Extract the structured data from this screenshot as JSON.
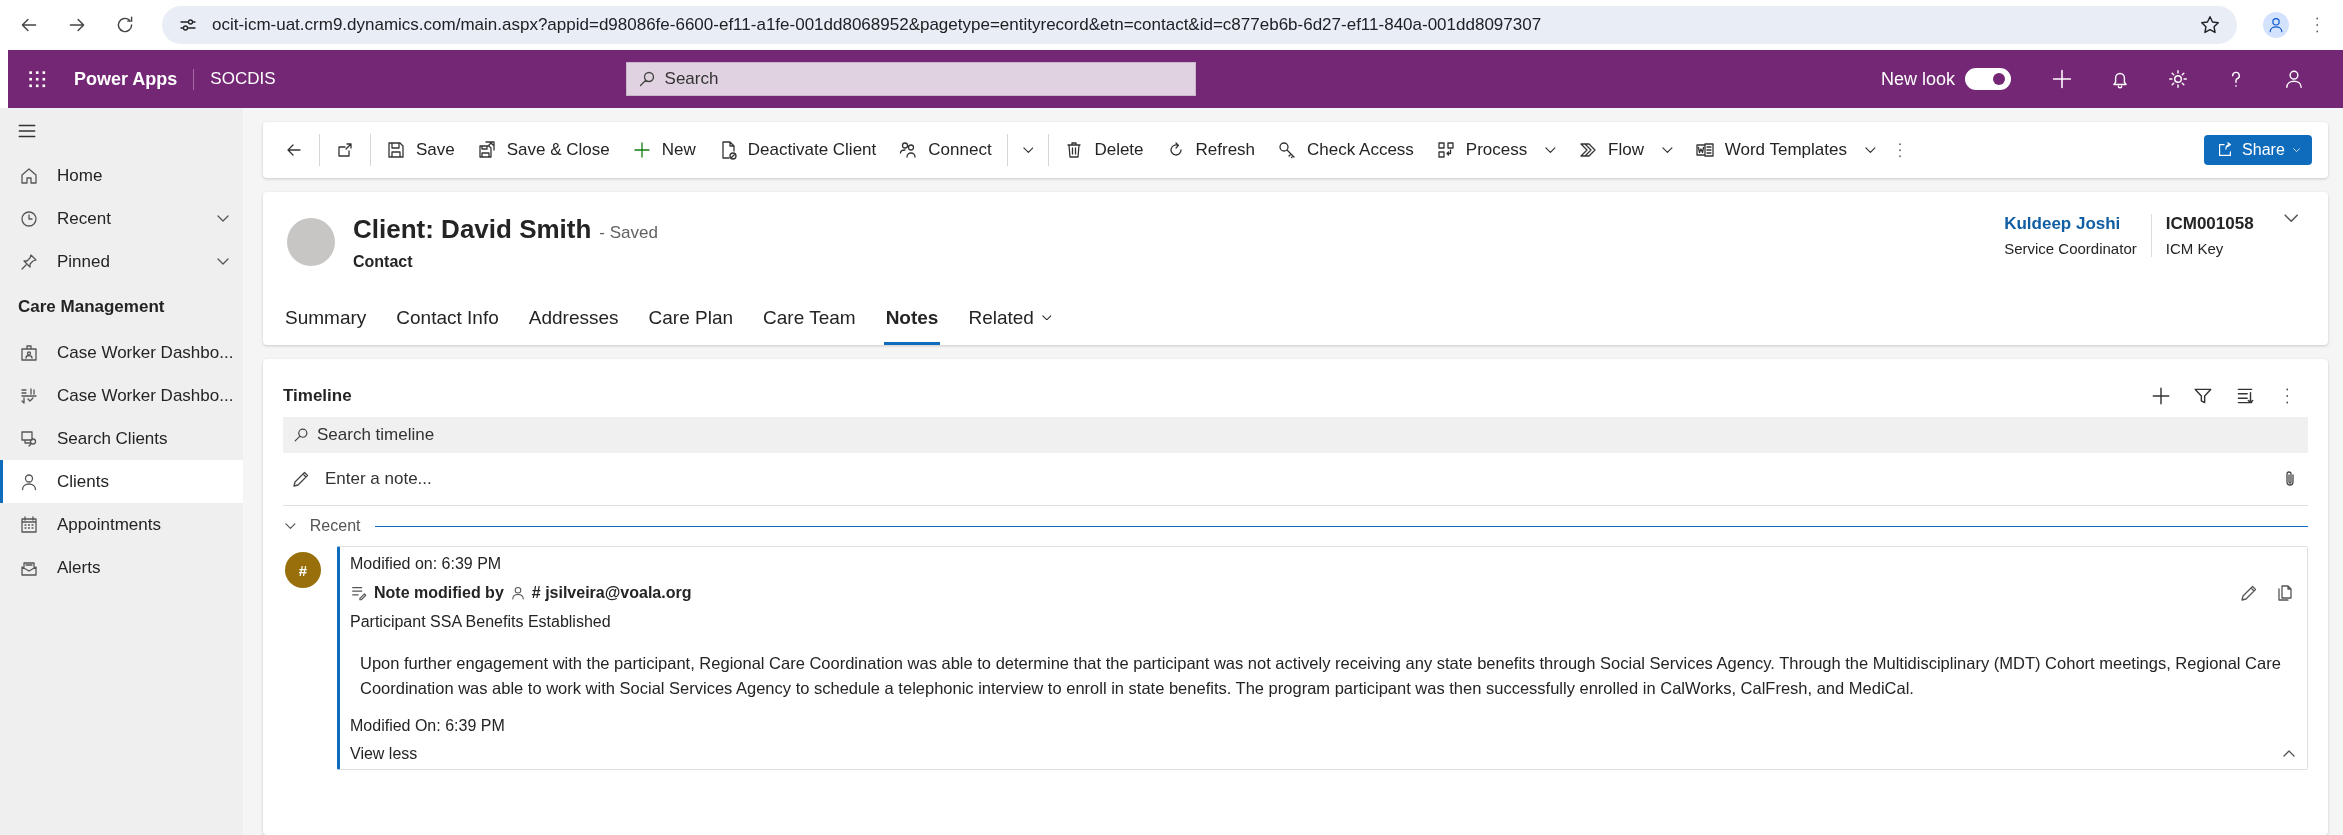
{
  "browser": {
    "url": "ocit-icm-uat.crm9.dynamics.com/main.aspx?appid=d98086fe-6600-ef11-a1fe-001dd8068952&pagetype=entityrecord&etn=contact&id=c877eb6b-6d27-ef11-840a-001dd8097307"
  },
  "app_bar": {
    "app_name": "Power Apps",
    "environment": "SOCDIS",
    "search_placeholder": "Search",
    "new_look_label": "New look",
    "new_look_on": true
  },
  "sidebar": {
    "items": [
      {
        "label": "Home",
        "expandable": false,
        "selected": false
      },
      {
        "label": "Recent",
        "expandable": true,
        "selected": false
      },
      {
        "label": "Pinned",
        "expandable": true,
        "selected": false
      }
    ],
    "group": {
      "title": "Care Management",
      "items": [
        {
          "label": "Case Worker Dashbo...",
          "selected": false
        },
        {
          "label": "Case Worker Dashbo...",
          "selected": false
        },
        {
          "label": "Search Clients",
          "selected": false
        },
        {
          "label": "Clients",
          "selected": true
        },
        {
          "label": "Appointments",
          "selected": false
        },
        {
          "label": "Alerts",
          "selected": false
        }
      ]
    }
  },
  "commands": [
    {
      "label": "Save",
      "kind": "button"
    },
    {
      "label": "Save & Close",
      "kind": "button"
    },
    {
      "label": "New",
      "kind": "button"
    },
    {
      "label": "Deactivate Client",
      "kind": "button"
    },
    {
      "label": "Connect",
      "kind": "split"
    },
    {
      "label": "Delete",
      "kind": "button"
    },
    {
      "label": "Refresh",
      "kind": "button"
    },
    {
      "label": "Check Access",
      "kind": "button"
    },
    {
      "label": "Process",
      "kind": "menu"
    },
    {
      "label": "Flow",
      "kind": "menu"
    },
    {
      "label": "Word Templates",
      "kind": "menu"
    }
  ],
  "share_button": {
    "label": "Share"
  },
  "record": {
    "title": "Client: David Smith",
    "status": "- Saved",
    "entity": "Contact",
    "owner_name": "Kuldeep Joshi",
    "owner_role": "Service Coordinator",
    "key_value": "ICM001058",
    "key_label": "ICM Key"
  },
  "tabs": [
    {
      "label": "Summary",
      "kind": "tab",
      "selected": false
    },
    {
      "label": "Contact Info",
      "kind": "tab",
      "selected": false
    },
    {
      "label": "Addresses",
      "kind": "tab",
      "selected": false
    },
    {
      "label": "Care Plan",
      "kind": "tab",
      "selected": false
    },
    {
      "label": "Care Team",
      "kind": "tab",
      "selected": false
    },
    {
      "label": "Notes",
      "kind": "tab",
      "selected": true
    },
    {
      "label": "Related",
      "kind": "menu",
      "selected": false
    }
  ],
  "timeline": {
    "title": "Timeline",
    "search_placeholder": "Search timeline",
    "note_placeholder": "Enter a note...",
    "group_label": "Recent",
    "group_expanded": true,
    "entries": [
      {
        "avatar_text": "#",
        "modified_top": "Modified on: 6:39 PM",
        "heading": "Note modified by",
        "author": "# jsilveira@voala.org",
        "subject": "Participant SSA Benefits Established",
        "body": "Upon further engagement with the participant, Regional Care Coordination was able to determine that the participant was not actively receiving any state benefits through Social Services Agency. Through the Multidisciplinary (MDT) Cohort meetings, Regional Care Coordination was able to work with Social Services Agency to schedule a telephonic interview to enroll in state benefits. The program participant was then successfully enrolled in CalWorks, CalFresh, and MediCal.",
        "modified_bottom": "Modified On: 6:39 PM",
        "toggle_label": "View less",
        "expanded": true
      }
    ]
  }
}
